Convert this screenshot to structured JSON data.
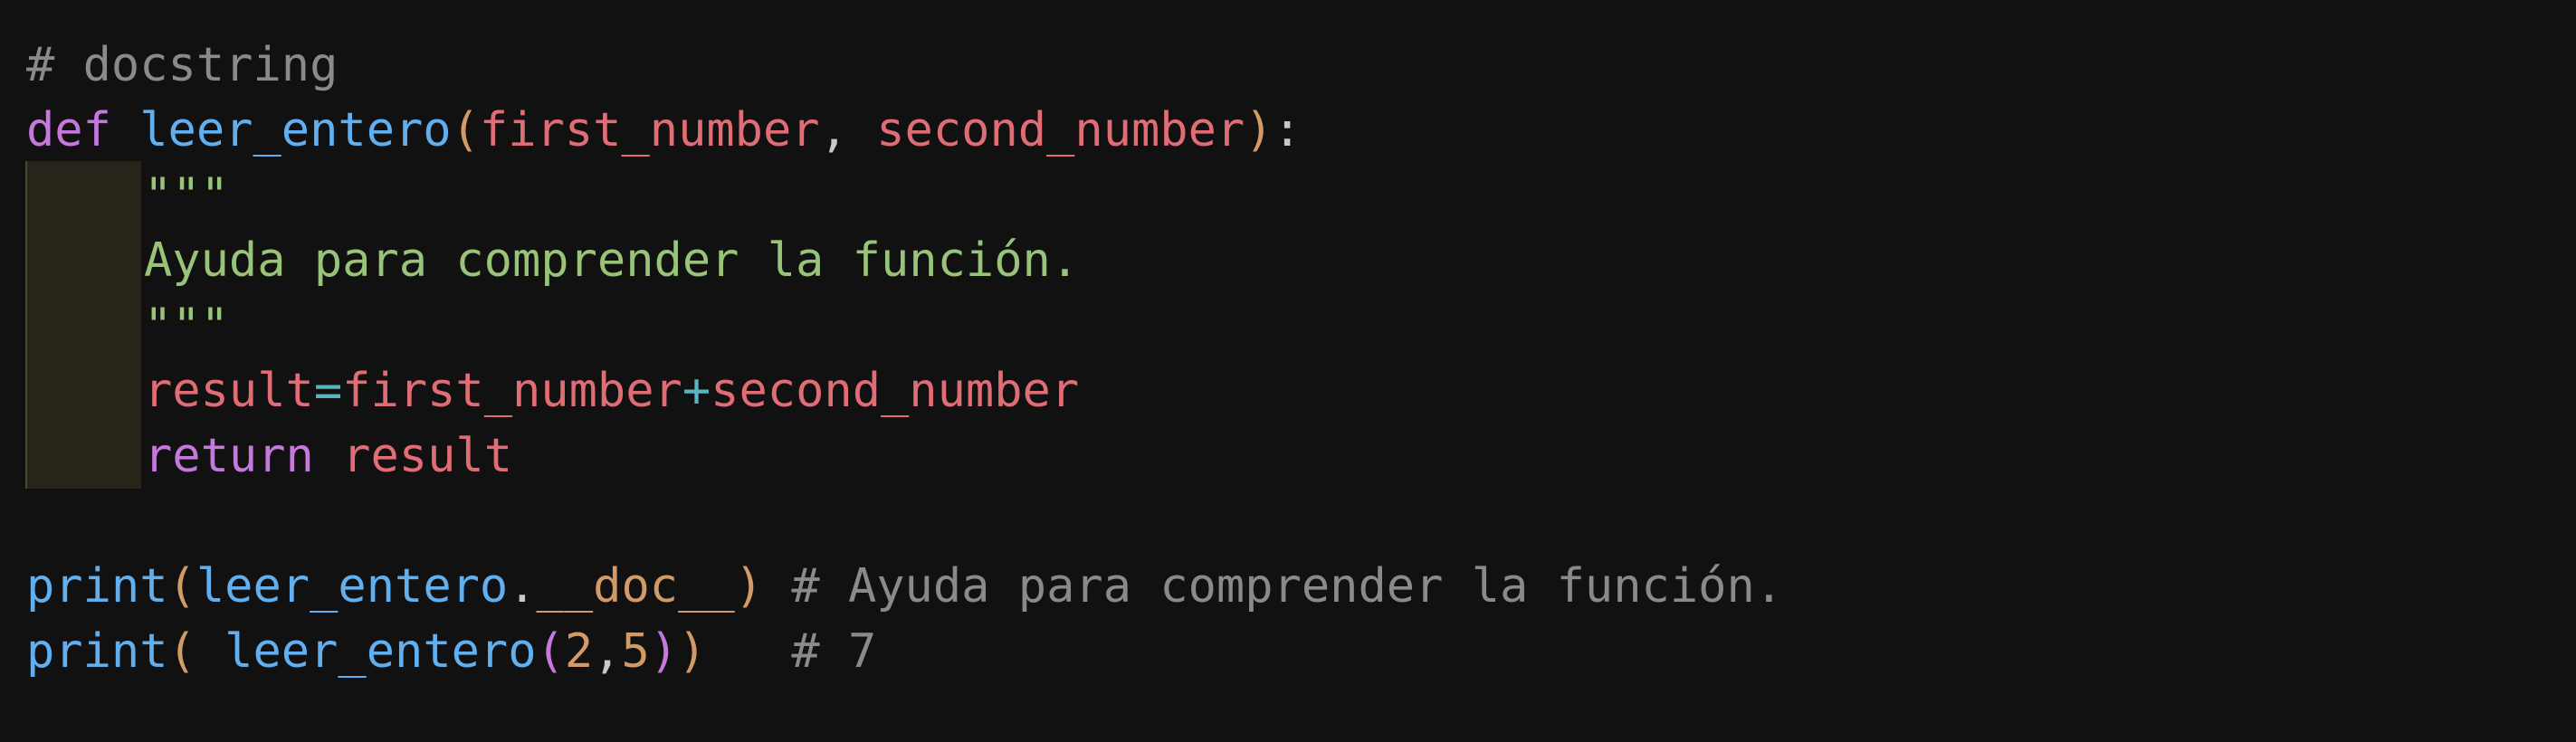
{
  "editor": {
    "language": "python",
    "theme": "dark",
    "lines": [
      [
        "# docstring"
      ],
      [
        "def",
        " ",
        "leer_entero",
        "(",
        "first_number",
        ", ",
        "second_number",
        ")",
        ":"
      ],
      [
        "\"\"\""
      ],
      [
        "Ayuda para comprender la función."
      ],
      [
        "\"\"\""
      ],
      [
        "result",
        "=",
        "first_number",
        "+",
        "second_number"
      ],
      [
        "return",
        " ",
        "result"
      ],
      [
        ""
      ],
      [
        "print",
        "(",
        "leer_entero",
        ".",
        "__doc__",
        ")",
        " ",
        "# Ayuda para comprender la función."
      ],
      [
        "print",
        "(",
        " ",
        "leer_entero",
        "(",
        "2",
        ",",
        "5",
        ")",
        ")",
        "   ",
        "# 7"
      ]
    ]
  },
  "colors": {
    "background": "#111111",
    "comment": "#8a8a8a",
    "keyword": "#c678dd",
    "function": "#61afef",
    "parameter": "#e06c75",
    "string": "#98c379",
    "operator": "#56b6c2",
    "number": "#d19a66"
  }
}
